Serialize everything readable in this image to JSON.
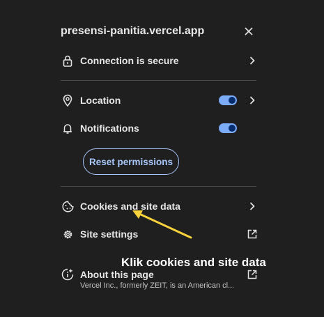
{
  "header": {
    "site": "presensi-panitia.vercel.app",
    "close_icon": "close-icon"
  },
  "connection": {
    "label": "Connection is secure",
    "icon": "lock-icon"
  },
  "permissions": [
    {
      "label": "Location",
      "icon": "location-pin-icon",
      "enabled": true
    },
    {
      "label": "Notifications",
      "icon": "bell-icon",
      "enabled": true
    }
  ],
  "reset_button": {
    "label": "Reset permissions"
  },
  "cookies": {
    "label": "Cookies and site data",
    "icon": "cookie-icon"
  },
  "site_settings": {
    "label": "Site settings",
    "icon": "gear-icon"
  },
  "about": {
    "label": "About this page",
    "icon": "info-icon",
    "subtitle": "Vercel Inc., formerly ZEIT, is an American cl..."
  },
  "annotation": {
    "text": "Klik cookies and site data",
    "color": "#f7d23c"
  },
  "colors": {
    "background": "#1f1f1f",
    "accent": "#a8c7fa",
    "toggle_on": "#7cacf8"
  }
}
